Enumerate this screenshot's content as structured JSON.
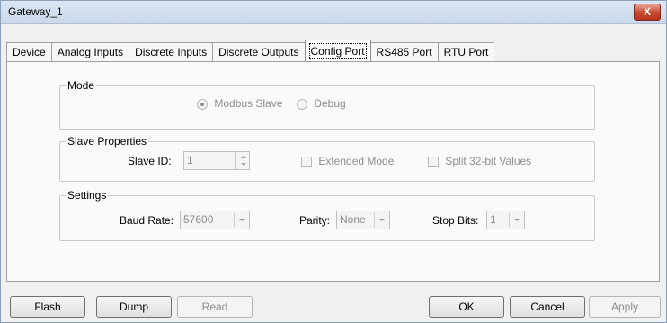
{
  "window": {
    "title": "Gateway_1",
    "close_glyph": "X"
  },
  "tabs": [
    {
      "label": "Device"
    },
    {
      "label": "Analog Inputs"
    },
    {
      "label": "Discrete Inputs"
    },
    {
      "label": "Discrete Outputs"
    },
    {
      "label": "Config Port",
      "active": true
    },
    {
      "label": "RS485 Port"
    },
    {
      "label": "RTU Port"
    }
  ],
  "mode": {
    "legend": "Mode",
    "modbus_slave_label": "Modbus Slave",
    "modbus_slave_selected": true,
    "debug_label": "Debug",
    "debug_selected": false
  },
  "slave": {
    "legend": "Slave Properties",
    "slave_id_label": "Slave ID:",
    "slave_id_value": "1",
    "extended_mode_label": "Extended Mode",
    "split_label": "Split 32-bit Values"
  },
  "settings": {
    "legend": "Settings",
    "baud_label": "Baud Rate:",
    "baud_value": "57600",
    "parity_label": "Parity:",
    "parity_value": "None",
    "stop_bits_label": "Stop Bits:",
    "stop_bits_value": "1"
  },
  "buttons": {
    "flash": "Flash",
    "dump": "Dump",
    "read": "Read",
    "ok": "OK",
    "cancel": "Cancel",
    "apply": "Apply"
  },
  "colors": {
    "close_button": "#c7442d",
    "disabled_text": "#8d8d8d"
  }
}
